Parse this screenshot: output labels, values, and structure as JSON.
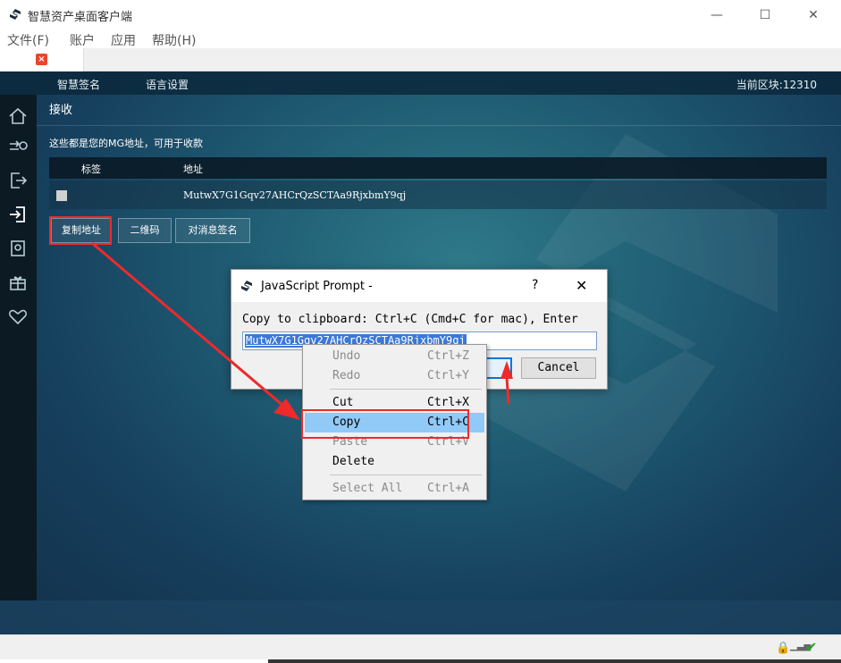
{
  "window": {
    "title": "智慧资产桌面客户端",
    "minimize_glyph": "—",
    "maximize_glyph": "☐",
    "close_glyph": "✕"
  },
  "menu": {
    "file": "文件(F)",
    "account": "账户",
    "app": "应用",
    "help": "帮助(H)"
  },
  "tab": {
    "close_glyph": "×"
  },
  "topnav": {
    "smart_sign": "智慧签名",
    "language": "语言设置",
    "current_block": "当前区块:12310"
  },
  "sidebar": {
    "icons": [
      "home-icon",
      "send-icon",
      "logout-icon",
      "receive-icon",
      "vault-icon",
      "gift-icon",
      "heart-icon"
    ]
  },
  "page": {
    "title": "接收",
    "description": "这些都是您的MG地址，可用于收款",
    "table": {
      "headers": [
        "标签",
        "地址"
      ],
      "rows": [
        {
          "label": "",
          "address": "MutwX7G1Gqv27AHCrQzSCTAa9RjxbmY9qj"
        }
      ]
    },
    "buttons": {
      "copy_address": "复制地址",
      "qr_code": "二维码",
      "sign_message": "对消息签名"
    }
  },
  "dialog": {
    "title": "JavaScript Prompt -",
    "help_glyph": "?",
    "close_glyph": "✕",
    "message": "Copy to clipboard: Ctrl+C (Cmd+C for mac), Enter",
    "input_value": "MutwX7G1Gqv27AHCrQzSCTAa9RjxbmY9qj",
    "cancel_label": "Cancel"
  },
  "context_menu": {
    "items": [
      {
        "label": "Undo",
        "shortcut": "Ctrl+Z",
        "enabled": false
      },
      {
        "label": "Redo",
        "shortcut": "Ctrl+Y",
        "enabled": false
      },
      {
        "label": "Cut",
        "shortcut": "Ctrl+X",
        "enabled": true
      },
      {
        "label": "Copy",
        "shortcut": "Ctrl+C",
        "enabled": true,
        "highlighted": true
      },
      {
        "label": "Paste",
        "shortcut": "Ctrl+V",
        "enabled": false
      },
      {
        "label": "Delete",
        "shortcut": "",
        "enabled": true
      },
      {
        "label": "Select All",
        "shortcut": "Ctrl+A",
        "enabled": false
      }
    ]
  },
  "status": {
    "lock_icon": "lock-icon",
    "signal_icon": "signal-icon",
    "check_icon": "check-icon"
  },
  "colors": {
    "annotation_red": "#ee2a2a",
    "selection_blue": "#3b78d8",
    "menu_highlight": "#91c9f7"
  }
}
